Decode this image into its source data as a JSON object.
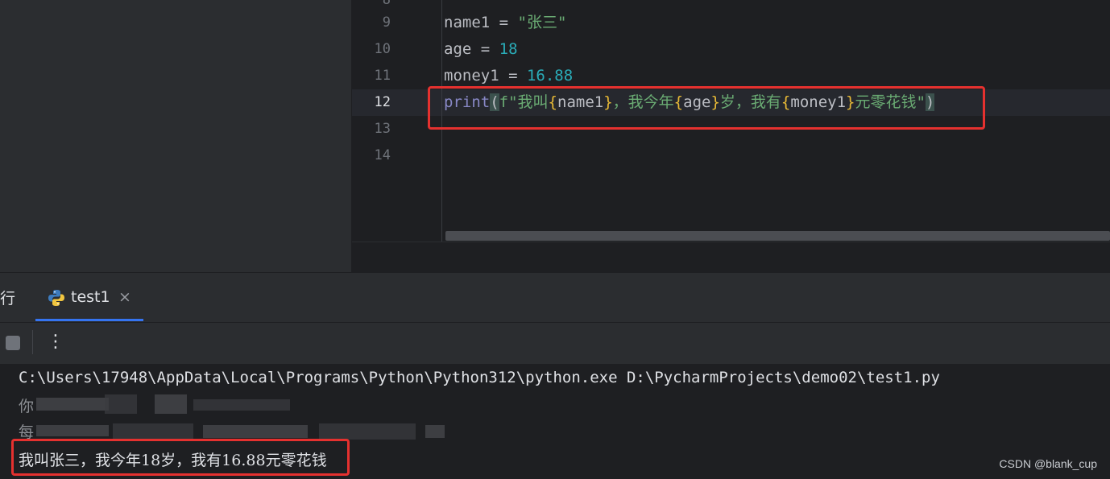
{
  "editor": {
    "lines": [
      {
        "num": "8"
      },
      {
        "num": "9"
      },
      {
        "num": "10"
      },
      {
        "num": "11"
      },
      {
        "num": "12"
      },
      {
        "num": "13"
      },
      {
        "num": "14"
      }
    ],
    "code": {
      "l9": {
        "var": "name1",
        "op": " = ",
        "str": "\"张三\""
      },
      "l10": {
        "var": "age",
        "op": " = ",
        "num": "18"
      },
      "l11": {
        "var": "money1",
        "op": " = ",
        "num": "16.88"
      },
      "l12": {
        "fn": "print",
        "open": "(",
        "fprefix": "f\"我叫",
        "b1o": "{",
        "v1": "name1",
        "b1c": "}",
        "s1": "，我今年",
        "b2o": "{",
        "v2": "age",
        "b2c": "}",
        "s2": "岁，我有",
        "b3o": "{",
        "v3": "money1",
        "b3c": "}",
        "s3": "元零花钱\"",
        "close": ")"
      }
    }
  },
  "run_panel": {
    "title": "行",
    "tab_label": "test1",
    "tab_close": "×",
    "kebab": "⋮"
  },
  "console": {
    "command": "C:\\Users\\17948\\AppData\\Local\\Programs\\Python\\Python312\\python.exe D:\\PycharmProjects\\demo02\\test1.py",
    "line2_prefix": "你",
    "line3_prefix": "每",
    "result": "我叫张三，我今年18岁，我有16.88元零花钱"
  },
  "watermark": "CSDN @blank_cup",
  "colors": {
    "highlight_box": "#e5312f",
    "accent_tab": "#3574f0",
    "string": "#6aab73",
    "number": "#2aacb8",
    "function": "#8888c6",
    "brace": "#e8ba36"
  }
}
